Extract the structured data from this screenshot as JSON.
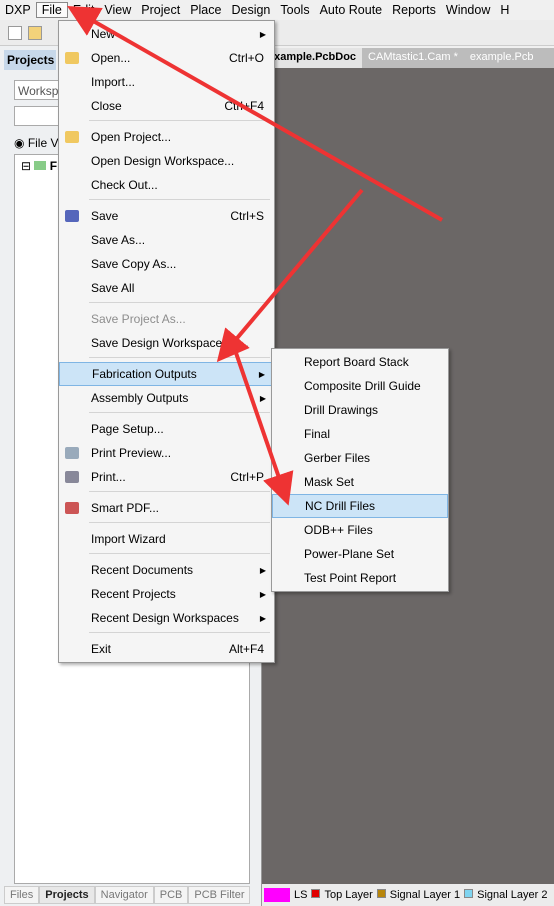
{
  "menubar": [
    "DXP",
    "File",
    "Edit",
    "View",
    "Project",
    "Place",
    "Design",
    "Tools",
    "Auto Route",
    "Reports",
    "Window",
    "H"
  ],
  "panel": {
    "title": "Projects",
    "workspace": "Worksp",
    "file_view": "File Vi",
    "tree_root": "Fr"
  },
  "doc_tabs": [
    "example.PcbDoc",
    "CAMtastic1.Cam *",
    "example.Pcb"
  ],
  "bottom_tabs": [
    "Files",
    "Projects",
    "Navigator",
    "PCB",
    "PCB Filter"
  ],
  "layers": {
    "ls": "LS",
    "items": [
      {
        "label": "Top Layer",
        "color": "#e00000"
      },
      {
        "label": "Signal Layer 1",
        "color": "#b8860b"
      },
      {
        "label": "Signal Layer 2",
        "color": "#7fd4f0"
      }
    ],
    "current_color": "#ff00ff"
  },
  "file_menu": [
    {
      "label": "New",
      "sub": true
    },
    {
      "label": "Open...",
      "shortcut": "Ctrl+O",
      "icon": "folder"
    },
    {
      "label": "Import..."
    },
    {
      "label": "Close",
      "shortcut": "Ctrl+F4"
    },
    {
      "sep": true
    },
    {
      "label": "Open Project...",
      "icon": "folder"
    },
    {
      "label": "Open Design Workspace..."
    },
    {
      "label": "Check Out..."
    },
    {
      "sep": true
    },
    {
      "label": "Save",
      "shortcut": "Ctrl+S",
      "icon": "save"
    },
    {
      "label": "Save As..."
    },
    {
      "label": "Save Copy As..."
    },
    {
      "label": "Save All"
    },
    {
      "sep": true
    },
    {
      "label": "Save Project As...",
      "disabled": true
    },
    {
      "label": "Save Design Workspace As..."
    },
    {
      "sep": true
    },
    {
      "label": "Fabrication Outputs",
      "sub": true,
      "highlight": true
    },
    {
      "label": "Assembly Outputs",
      "sub": true
    },
    {
      "sep": true
    },
    {
      "label": "Page Setup..."
    },
    {
      "label": "Print Preview...",
      "icon": "preview"
    },
    {
      "label": "Print...",
      "shortcut": "Ctrl+P",
      "icon": "print"
    },
    {
      "sep": true
    },
    {
      "label": "Smart PDF...",
      "icon": "pdf"
    },
    {
      "sep": true
    },
    {
      "label": "Import Wizard"
    },
    {
      "sep": true
    },
    {
      "label": "Recent Documents",
      "sub": true
    },
    {
      "label": "Recent Projects",
      "sub": true
    },
    {
      "label": "Recent Design Workspaces",
      "sub": true
    },
    {
      "sep": true
    },
    {
      "label": "Exit",
      "shortcut": "Alt+F4"
    }
  ],
  "fab_submenu": [
    {
      "label": "Report Board Stack"
    },
    {
      "label": "Composite Drill Guide"
    },
    {
      "label": "Drill Drawings"
    },
    {
      "label": "Final"
    },
    {
      "label": "Gerber Files"
    },
    {
      "label": "Mask Set"
    },
    {
      "label": "NC Drill Files",
      "highlight": true
    },
    {
      "label": "ODB++ Files"
    },
    {
      "label": "Power-Plane Set"
    },
    {
      "label": "Test Point Report"
    }
  ],
  "annotation_color": "#ee3333"
}
